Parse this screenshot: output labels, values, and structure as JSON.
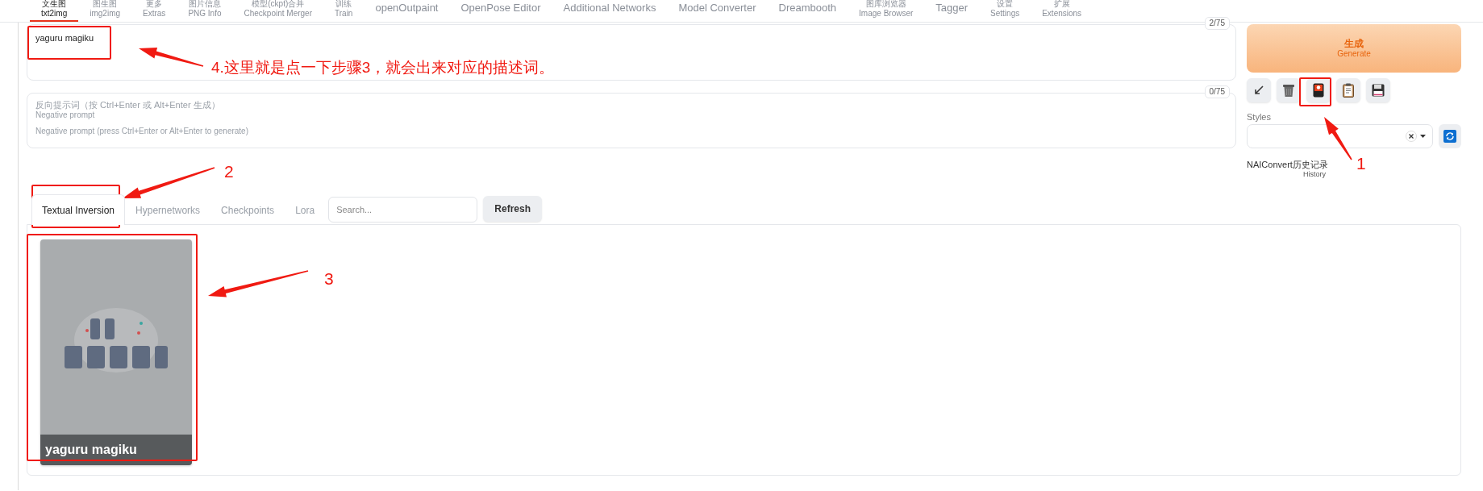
{
  "top_tabs": [
    {
      "label": "文生图",
      "sublabel": "txt2img",
      "selected": true
    },
    {
      "label": "图生图",
      "sublabel": "img2img",
      "selected": false
    },
    {
      "label": "更多",
      "sublabel": "Extras",
      "selected": false
    },
    {
      "label": "图片信息",
      "sublabel": "PNG Info",
      "selected": false
    },
    {
      "label": "模型(ckpt)合并",
      "sublabel": "Checkpoint Merger",
      "selected": false
    },
    {
      "label": "训练",
      "sublabel": "Train",
      "selected": false
    },
    {
      "label": "openOutpaint",
      "selected": false
    },
    {
      "label": "OpenPose Editor",
      "selected": false
    },
    {
      "label": "Additional Networks",
      "selected": false
    },
    {
      "label": "Model Converter",
      "selected": false
    },
    {
      "label": "Dreambooth",
      "selected": false
    },
    {
      "label": "图库浏览器",
      "sublabel": "Image Browser",
      "selected": false
    },
    {
      "label": "Tagger",
      "selected": false
    },
    {
      "label": "设置",
      "sublabel": "Settings",
      "selected": false
    },
    {
      "label": "扩展",
      "sublabel": "Extensions",
      "selected": false
    }
  ],
  "prompt": {
    "value": "yaguru magiku",
    "counter": "2/75"
  },
  "negative_prompt": {
    "label": "反向提示词（按 Ctrl+Enter 或 Alt+Enter 生成）",
    "sublabel": "Negative prompt",
    "placeholder": "Negative prompt (press Ctrl+Enter or Alt+Enter to generate)",
    "counter": "0/75"
  },
  "generate_button": {
    "label": "生成",
    "sublabel": "Generate"
  },
  "styles": {
    "label": "Styles"
  },
  "history": {
    "label": "NAIConvert历史记录",
    "sublabel": "History"
  },
  "network_tabs": [
    {
      "label": "Textual Inversion",
      "selected": true
    },
    {
      "label": "Hypernetworks",
      "selected": false
    },
    {
      "label": "Checkpoints",
      "selected": false
    },
    {
      "label": "Lora",
      "selected": false
    }
  ],
  "search": {
    "placeholder": "Search..."
  },
  "refresh_button": "Refresh",
  "cards": [
    {
      "name": "yaguru magiku"
    }
  ],
  "annotations": {
    "note": "4.这里就是点一下步骤3，就会出来对应的描述词。",
    "steps": [
      "1",
      "2",
      "3"
    ]
  }
}
